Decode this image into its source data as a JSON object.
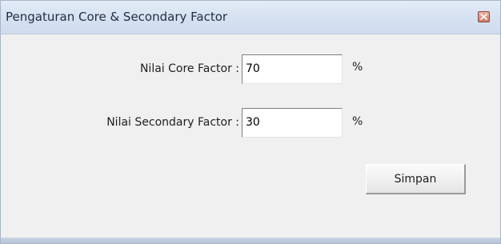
{
  "window": {
    "title": "Pengaturan Core & Secondary Factor",
    "close_icon": "close-icon"
  },
  "form": {
    "core": {
      "label": "Nilai Core Factor :",
      "value": "70",
      "unit": "%"
    },
    "secondary": {
      "label": "Nilai Secondary Factor :",
      "value": "30",
      "unit": "%"
    },
    "save_label": "Simpan"
  },
  "colors": {
    "titlebar": "#d6e2f1",
    "client_background": "#f0f0f0",
    "close_button": "#cf7a63"
  }
}
